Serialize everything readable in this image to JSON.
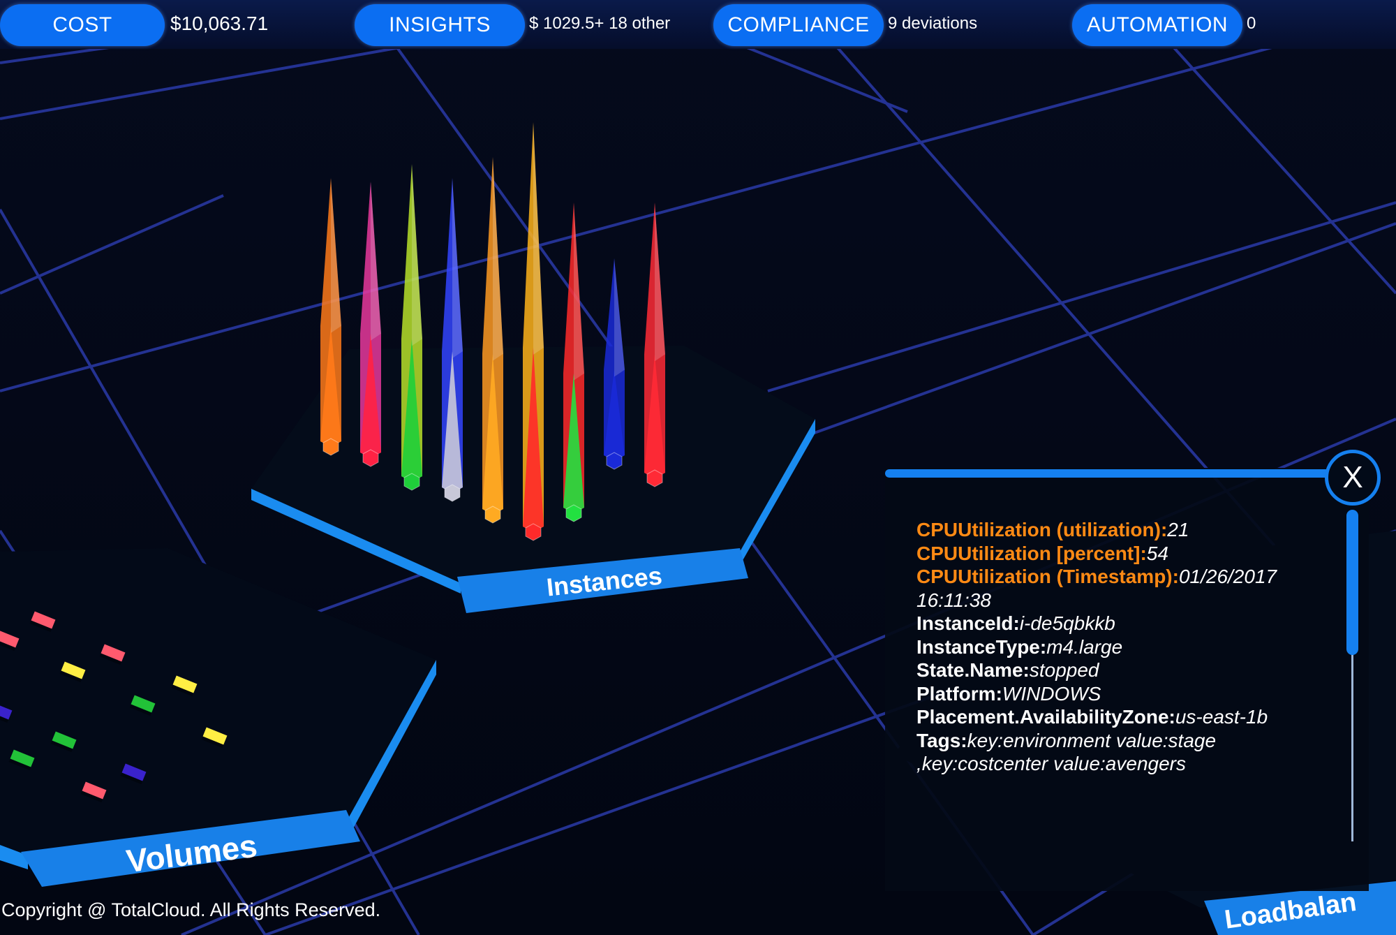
{
  "topbar": {
    "items": [
      {
        "label": "COST",
        "value": "$10,063.71"
      },
      {
        "label": "INSIGHTS",
        "value": "$ 1029.5+ 18 other"
      },
      {
        "label": "COMPLIANCE",
        "value": "9 deviations"
      },
      {
        "label": "AUTOMATION",
        "value": "0"
      }
    ]
  },
  "scene": {
    "instances_label": "Instances",
    "volumes_label": "Volumes",
    "loadbalancer_label": "Loadbalan",
    "grid_color": "#2a3aa8",
    "platform_color": "#1580ef"
  },
  "details": {
    "close_label": "X",
    "rows": [
      {
        "key": "CPUUtilization (utilization):",
        "value": "21"
      },
      {
        "key": "CPUUtilization [percent]:",
        "value": "54"
      },
      {
        "key": "CPUUtilization (Timestamp):",
        "value": "01/26/2017 16:11:38"
      },
      {
        "key": "InstanceId:",
        "value": "i-de5qbkkb"
      },
      {
        "key": "InstanceType:",
        "value": "m4.large"
      },
      {
        "key": "State.Name:",
        "value": "stopped"
      },
      {
        "key": "Platform:",
        "value": "WINDOWS"
      },
      {
        "key": "Placement.AvailabilityZone:",
        "value": "us-east-1b"
      },
      {
        "key": "Tags:",
        "value": "key:environment value:stage ,key:costcenter value:avengers"
      }
    ]
  },
  "footer": {
    "copyright": "Copyright @ TotalCloud. All Rights Reserved."
  }
}
